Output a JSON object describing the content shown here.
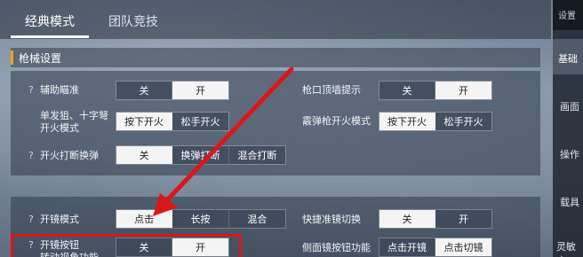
{
  "tabs": [
    {
      "label": "经典模式",
      "active": true
    },
    {
      "label": "团队竞技",
      "active": false
    }
  ],
  "section": {
    "title": "枪械设置"
  },
  "rows_top": [
    {
      "help": "?",
      "label": "辅助瞄准",
      "options": [
        "关",
        "开"
      ],
      "selected": 1
    },
    {
      "help": "",
      "label": "单发狙、十字弩\n开火模式",
      "options": [
        "按下开火",
        "松手开火"
      ],
      "selected": 0
    },
    {
      "help": "?",
      "label": "开火打断换弹",
      "options": [
        "关",
        "换弹打断",
        "混合打断"
      ],
      "selected": 0
    }
  ],
  "rows_top_right": [
    {
      "label": "枪口顶墙提示",
      "options": [
        "关",
        "开"
      ],
      "selected": 1
    },
    {
      "label": "霰弹枪开火模式",
      "options": [
        "按下开火",
        "松手开火"
      ],
      "selected": 0
    }
  ],
  "rows_bottom": [
    {
      "help": "?",
      "label": "开镜模式",
      "options": [
        "点击",
        "长按",
        "混合"
      ],
      "selected": 0
    },
    {
      "help": "?",
      "label": "开镜按钮\n转动视角功能",
      "options": [
        "关",
        "开"
      ],
      "selected": 1
    }
  ],
  "rows_bottom_right": [
    {
      "label": "快捷准镜切换",
      "options": [
        "关",
        "开"
      ],
      "selected": 0
    },
    {
      "label": "侧面镜按钮功能",
      "options": [
        "点击开镜",
        "点击切镜"
      ],
      "selected": 1
    }
  ],
  "right_panel": {
    "top": "设置",
    "items": [
      "基础",
      "画面",
      "操作",
      "载具",
      "灵敏度"
    ]
  },
  "colors": {
    "accent": "#f0a020",
    "annotation": "#d81818"
  }
}
